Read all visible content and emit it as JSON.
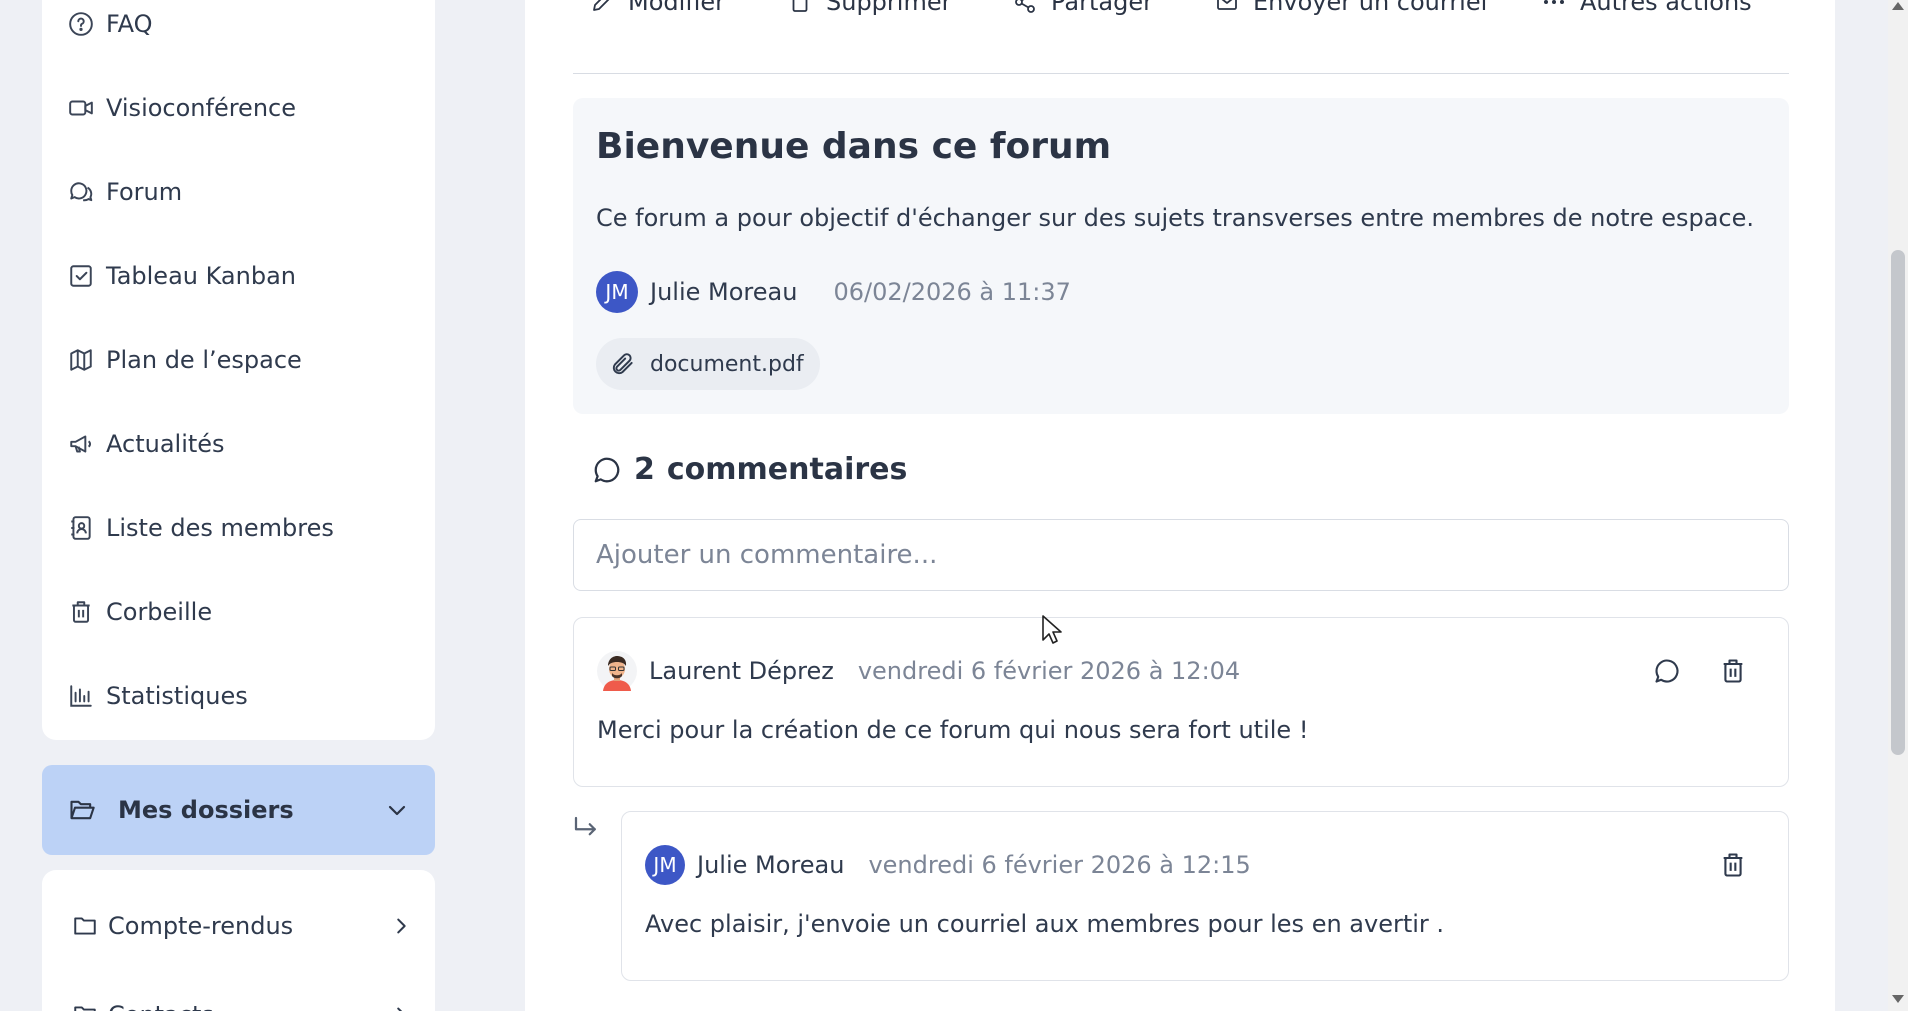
{
  "sidebar": {
    "items": [
      {
        "label": "FAQ",
        "icon": "help-circle-icon"
      },
      {
        "label": "Visioconférence",
        "icon": "video-icon"
      },
      {
        "label": "Forum",
        "icon": "chat-bubbles-icon"
      },
      {
        "label": "Tableau Kanban",
        "icon": "check-square-icon"
      },
      {
        "label": "Plan de l’espace",
        "icon": "map-icon"
      },
      {
        "label": "Actualités",
        "icon": "megaphone-icon"
      },
      {
        "label": "Liste des membres",
        "icon": "contact-book-icon"
      },
      {
        "label": "Corbeille",
        "icon": "trash-icon"
      },
      {
        "label": "Statistiques",
        "icon": "bar-chart-icon"
      }
    ],
    "folders_label": "Mes dossiers",
    "folders": [
      {
        "label": "Compte-rendus"
      },
      {
        "label": "Contacts"
      }
    ]
  },
  "toolbar": {
    "edit_label": "Modifier",
    "delete_label": "Supprimer",
    "share_label": "Partager",
    "email_label": "Envoyer un courriel",
    "more_label": "Autres actions"
  },
  "post": {
    "title": "Bienvenue dans ce forum",
    "body": "Ce forum a pour objectif d'échanger sur des sujets transverses entre membres de notre espace.",
    "author_initials": "JM",
    "author": "Julie Moreau",
    "datetime": "06/02/2026 à 11:37",
    "attachment": "document.pdf"
  },
  "comments": {
    "count": "2",
    "heading": "commentaires",
    "input_placeholder": "Ajouter un commentaire...",
    "items": [
      {
        "author": "Laurent Déprez",
        "datetime": "vendredi 6 février 2026 à 12:04",
        "text": "Merci pour la création de ce forum qui nous sera fort utile !"
      },
      {
        "author_initials": "JM",
        "author": "Julie Moreau",
        "datetime": "vendredi 6 février 2026 à 12:15",
        "text": "Avec plaisir, j'envoie un courriel aux membres pour les en avertir ."
      }
    ]
  },
  "colors": {
    "accent": "#3d57c6",
    "folders_highlight": "#bcd2f6",
    "muted_text": "#7c8596"
  }
}
